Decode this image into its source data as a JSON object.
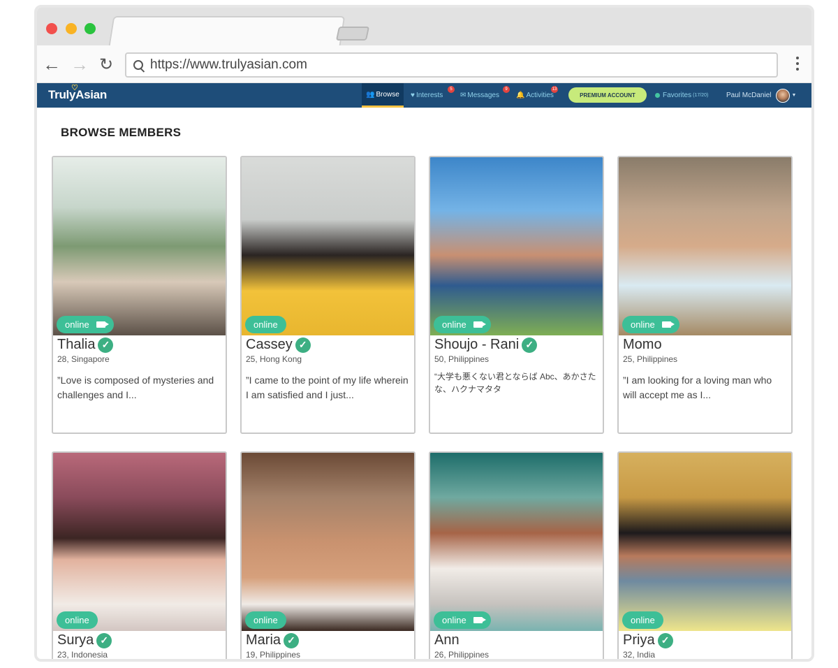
{
  "browser": {
    "url": "https://www.trulyasian.com"
  },
  "site": {
    "logo": "TrulyAsian",
    "nav": {
      "browse": "Browse",
      "interests": "Interests",
      "interests_badge": "5",
      "messages": "Messages",
      "messages_badge": "9",
      "activities": "Activities",
      "activities_badge": "13",
      "premium": "PREMIUM ACCOUNT",
      "favorites": "Favorites",
      "favorites_count": "(17/20)",
      "user": "Paul McDaniel"
    },
    "colors": {
      "header": "#1e4d79",
      "accent": "#f5c242",
      "online": "#3dbf97",
      "premium": "#c7ea7b"
    }
  },
  "page": {
    "title": "BROWSE MEMBERS",
    "online_label": "online",
    "members": [
      {
        "name": "Thalia",
        "meta": "28, Singapore",
        "bio": "”Love is composed of mysteries and challenges and I..."
      },
      {
        "name": "Cassey",
        "meta": "25, Hong Kong",
        "bio": "”I came to the point of my life wherein I am satisfied and I just..."
      },
      {
        "name": "Shoujo - Rani",
        "meta": "50, Philippines",
        "bio": "“大学も悪くない君とならば Abc、あかさたな、ハクナマタタ"
      },
      {
        "name": "Momo",
        "meta": "25, Philippines",
        "bio": "”I am looking for a loving man who will accept me as I..."
      },
      {
        "name": "Surya",
        "meta": "23, Indonesia",
        "bio": ""
      },
      {
        "name": "Maria",
        "meta": "19, Philippines",
        "bio": ""
      },
      {
        "name": "Ann",
        "meta": "26, Philippines",
        "bio": ""
      },
      {
        "name": "Priya",
        "meta": "32, India",
        "bio": ""
      }
    ]
  }
}
